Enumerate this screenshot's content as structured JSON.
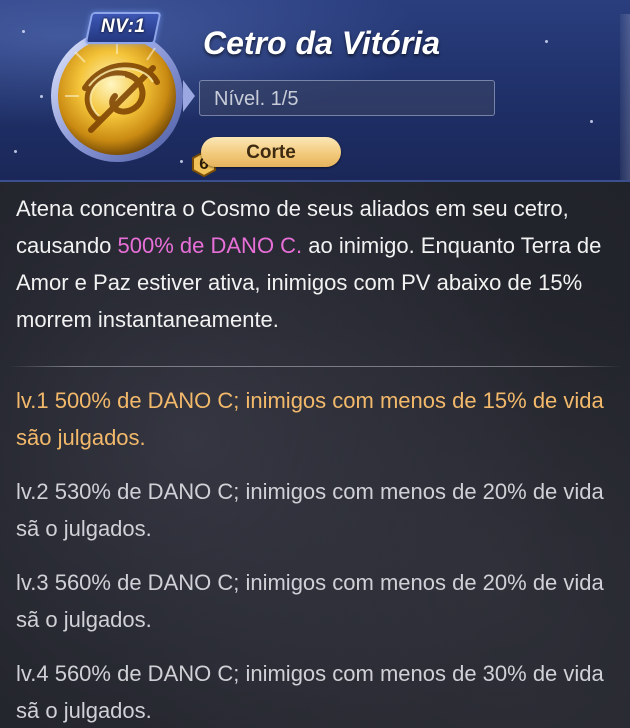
{
  "skill": {
    "title": "Cetro da Vitória",
    "nv_badge": "NV:1",
    "star_level": "6",
    "level_text": "Nível. 1/5",
    "tag": "Corte",
    "icon": "golden-scepter-swirl-icon"
  },
  "description": {
    "part1": "Atena concentra o Cosmo de seus aliados em seu cetro, causando ",
    "highlight": "500% de DANO C.",
    "part2": " ao inimigo. Enquanto Terra de Amor e Paz estiver ativa, inimigos com PV abaixo de 15% morrem instantaneamente."
  },
  "levels": [
    {
      "text": "lv.1 500% de DANO C; inimigos com menos de 15% de vida são julgados.",
      "current": true
    },
    {
      "text": "lv.2 530% de DANO C; inimigos com menos de 20% de vida sã o julgados.",
      "current": false
    },
    {
      "text": "lv.3 560% de DANO C; inimigos com menos de 20% de vida sã o julgados.",
      "current": false
    },
    {
      "text": "lv.4 560% de DANO C; inimigos com menos de 30% de vida sã o julgados.",
      "current": false
    }
  ],
  "colors": {
    "header_bg": "#1f3068",
    "highlight": "#e86fd8",
    "current_level": "#f3b96b",
    "tag_bg": "#f2c878"
  }
}
